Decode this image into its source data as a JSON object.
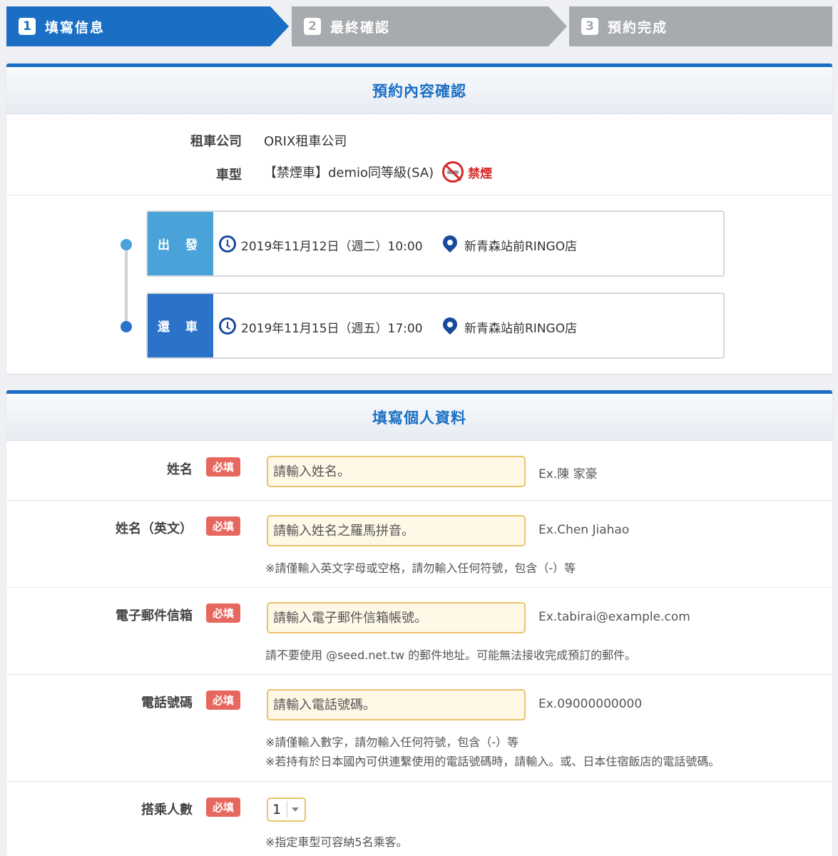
{
  "steps": [
    {
      "num": "1",
      "label": "填寫信息"
    },
    {
      "num": "2",
      "label": "最終確認"
    },
    {
      "num": "3",
      "label": "預約完成"
    }
  ],
  "confirm": {
    "title": "預約內容確認",
    "company_label": "租車公司",
    "company_value": "ORIX租車公司",
    "car_label": "車型",
    "car_value": "【禁煙車】demio同等級(SA)",
    "nosmoke_label": "禁煙"
  },
  "trip": {
    "depart": {
      "tag": "出 發",
      "datetime": "2019年11月12日（週二）10:00",
      "location": "新青森站前RINGO店"
    },
    "return": {
      "tag": "還 車",
      "datetime": "2019年11月15日（週五）17:00",
      "location": "新青森站前RINGO店"
    }
  },
  "colors": {
    "primary": "#1a6fc4",
    "depart_tag": "#4aa3d8",
    "return_tag": "#2b73c9",
    "required": "#e6675d",
    "input_bg": "#fff8e7"
  },
  "form": {
    "title": "填寫個人資料",
    "required_badge": "必填",
    "name": {
      "label": "姓名",
      "placeholder": "請輸入姓名。",
      "example": "Ex.陳 家豪"
    },
    "name_en": {
      "label": "姓名（英文）",
      "placeholder": "請輸入姓名之羅馬拼音。",
      "example": "Ex.Chen Jiahao",
      "note": "※請僅輸入英文字母或空格，請勿輸入任何符號，包含（-）等"
    },
    "email": {
      "label": "電子郵件信箱",
      "placeholder": "請輸入電子郵件信箱帳號。",
      "example": "Ex.tabirai@example.com",
      "note": "請不要使用 @seed.net.tw 的郵件地址。可能無法接收完成預訂的郵件。"
    },
    "phone": {
      "label": "電話號碼",
      "placeholder": "請輸入電話號碼。",
      "example": "Ex.09000000000",
      "note1": "※請僅輸入數字，請勿輸入任何符號，包含（-）等",
      "note2": "※若持有於日本國內可供連繫使用的電話號碼時，請輸入。或、日本住宿飯店的電話號碼。"
    },
    "passengers": {
      "label": "搭乘人數",
      "value": "1",
      "note": "※指定車型可容納5名乘客。"
    }
  }
}
